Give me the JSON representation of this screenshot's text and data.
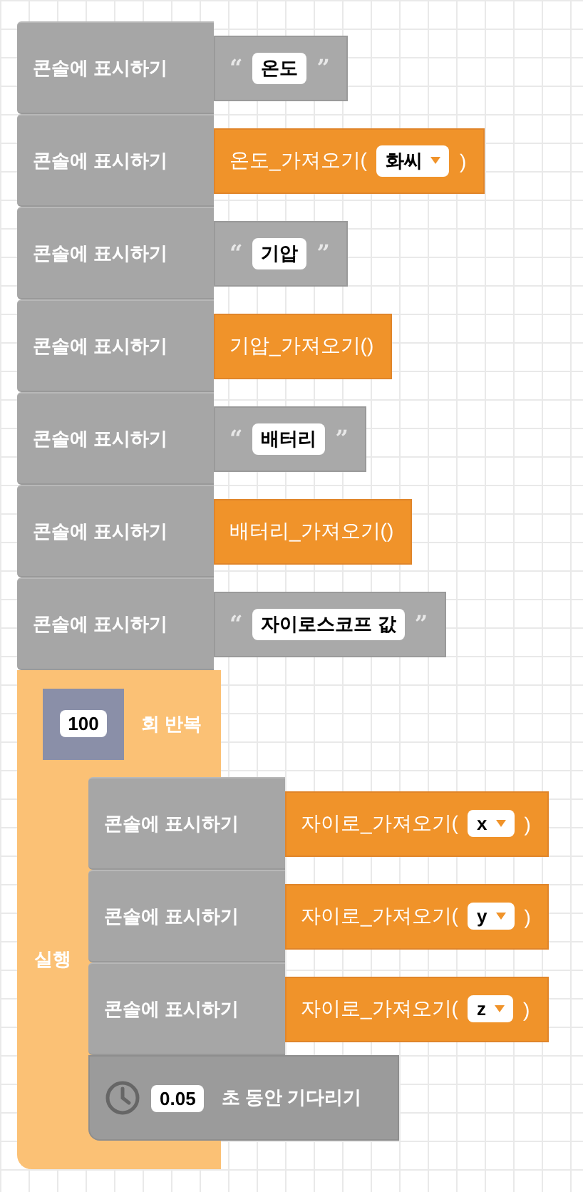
{
  "blocks": [
    {
      "kind": "print",
      "label": "콘솔에 표시하기",
      "value": {
        "kind": "text",
        "open_quote": "“",
        "text": "온도",
        "close_quote": "”"
      }
    },
    {
      "kind": "print",
      "label": "콘솔에 표시하기",
      "value": {
        "kind": "call",
        "name": "온도_가져오기(",
        "dropdown": "화씨",
        "close": ")"
      }
    },
    {
      "kind": "print",
      "label": "콘솔에 표시하기",
      "value": {
        "kind": "text",
        "open_quote": "“",
        "text": "기압",
        "close_quote": "”"
      }
    },
    {
      "kind": "print",
      "label": "콘솔에 표시하기",
      "value": {
        "kind": "call",
        "name": "기압_가져오기()"
      }
    },
    {
      "kind": "print",
      "label": "콘솔에 표시하기",
      "value": {
        "kind": "text",
        "open_quote": "“",
        "text": "배터리",
        "close_quote": "”"
      }
    },
    {
      "kind": "print",
      "label": "콘솔에 표시하기",
      "value": {
        "kind": "call",
        "name": "배터리_가져오기()"
      }
    },
    {
      "kind": "print",
      "label": "콘솔에 표시하기",
      "value": {
        "kind": "text",
        "open_quote": "“",
        "text": "자이로스코프 값",
        "close_quote": "”"
      }
    },
    {
      "kind": "repeat",
      "count": "100",
      "label": "회 반복",
      "do_label": "실행",
      "children": [
        {
          "kind": "print",
          "label": "콘솔에 표시하기",
          "value": {
            "kind": "call",
            "name": "자이로_가져오기(",
            "dropdown": "x",
            "close": ")"
          }
        },
        {
          "kind": "print",
          "label": "콘솔에 표시하기",
          "value": {
            "kind": "call",
            "name": "자이로_가져오기(",
            "dropdown": "y",
            "close": ")"
          }
        },
        {
          "kind": "print",
          "label": "콘솔에 표시하기",
          "value": {
            "kind": "call",
            "name": "자이로_가져오기(",
            "dropdown": "z",
            "close": ")"
          }
        },
        {
          "kind": "wait",
          "value": "0.05",
          "label": "초 동안 기다리기"
        }
      ]
    }
  ]
}
